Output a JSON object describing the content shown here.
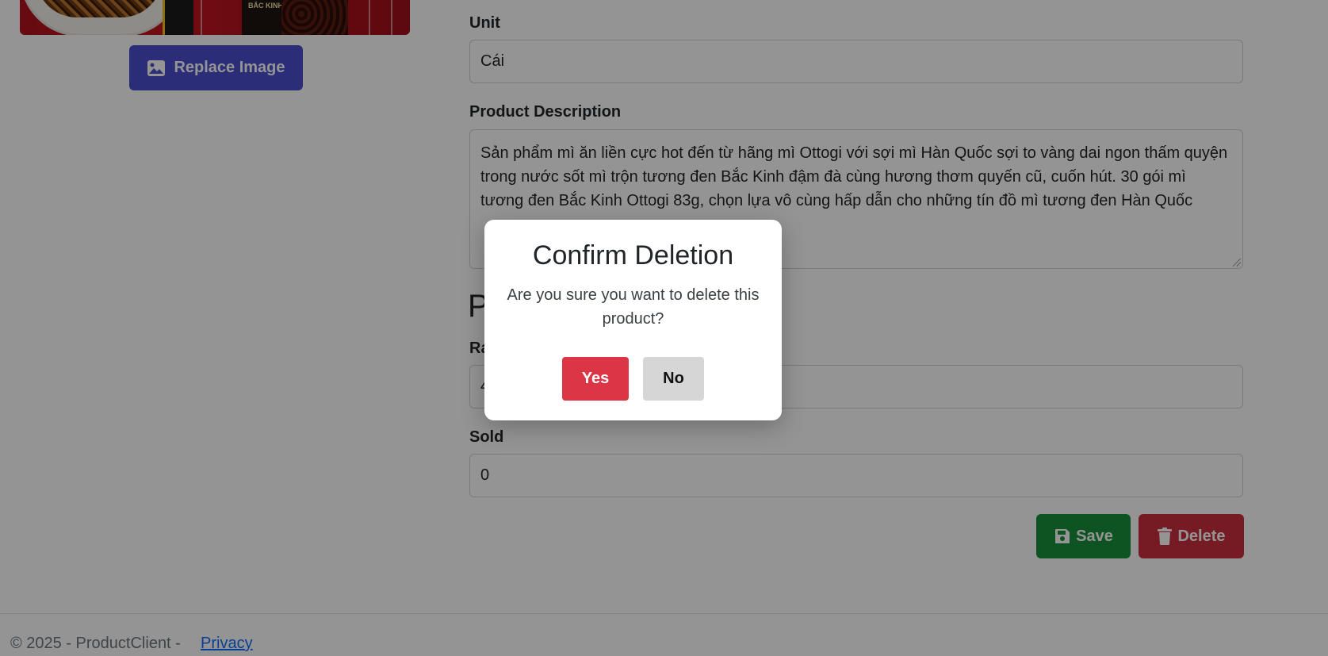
{
  "left_panel": {
    "image_alt": "Ottogi black bean noodle product image",
    "image_text": "BẮC KINH",
    "replace_button": "Replace Image"
  },
  "form": {
    "unit_label": "Unit",
    "unit_value": "Cái",
    "description_label": "Product Description",
    "description_value": "Sản phẩm mì ăn liền cực hot đến từ hãng mì Ottogi với sợi mì Hàn Quốc sợi to vàng dai ngon thấm quyện trong nước sốt mì trộn tương đen Bắc Kinh đậm đà cùng hương thơm quyến cũ, cuốn hút. 30 gói mì tương đen Bắc Kinh Ottogi 83g, chọn lựa vô cùng hấp dẫn cho những tín đồ mì tương đen Hàn Quốc",
    "section_heading_partial": "P",
    "rating_label_partial": "Ra",
    "rating_value_partial": "4",
    "sold_label": "Sold",
    "sold_value": "0",
    "save_button": "Save",
    "delete_button": "Delete"
  },
  "footer": {
    "copyright": "© 2025 - ProductClient -",
    "privacy_link": "Privacy"
  },
  "modal": {
    "title": "Confirm Deletion",
    "message": "Are you sure you want to delete this product?",
    "yes_button": "Yes",
    "no_button": "No"
  },
  "colors": {
    "replace_button": "#4a4fd1",
    "save_button": "#198f3b",
    "delete_button": "#cc2e3f",
    "yes_button": "#dc3545",
    "no_button": "#d6d6d6",
    "overlay": "rgba(0,0,0,0.42)"
  }
}
